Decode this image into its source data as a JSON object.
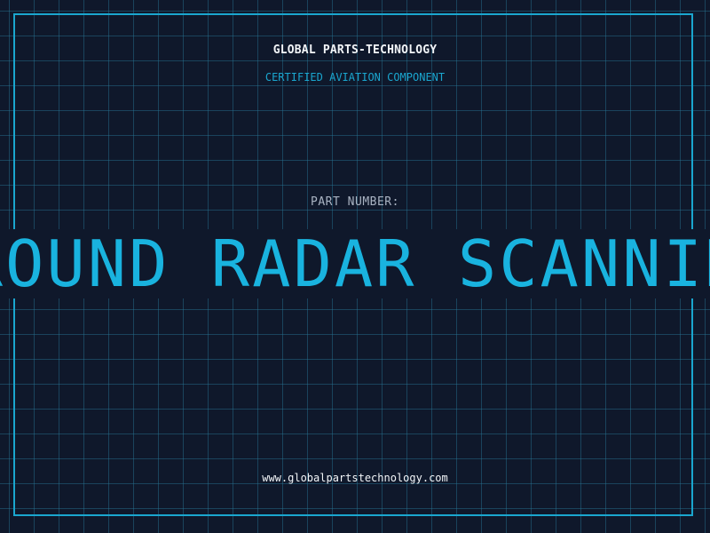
{
  "header": {
    "company": "GLOBAL PARTS-TECHNOLOGY",
    "tagline": "CERTIFIED AVIATION COMPONENT"
  },
  "part": {
    "label": "PART NUMBER:",
    "value": "GROUND RADAR SCANNING"
  },
  "footer": {
    "website": "www.globalpartstechnology.com"
  },
  "colors": {
    "background": "#0f182b",
    "accent": "#1aa6cf",
    "text": "#f2f5f8",
    "muted": "#a9b3c2"
  }
}
